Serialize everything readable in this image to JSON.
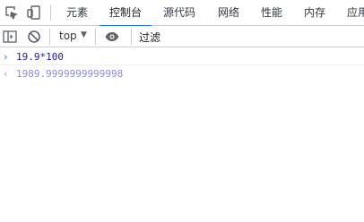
{
  "tabs": [
    {
      "label": "元素",
      "active": false
    },
    {
      "label": "控制台",
      "active": true
    },
    {
      "label": "源代码",
      "active": false
    },
    {
      "label": "网络",
      "active": false
    },
    {
      "label": "性能",
      "active": false
    },
    {
      "label": "内存",
      "active": false
    },
    {
      "label": "应用",
      "active": false
    }
  ],
  "toolbar": {
    "context": "top",
    "filter_label": "过滤"
  },
  "console": {
    "input": {
      "prompt_glyph": "›",
      "code": "19.9*100"
    },
    "output": {
      "prompt_glyph": "‹",
      "value": "1989.9999999999998"
    }
  },
  "colors": {
    "accent": "#1a73e8",
    "input_text": "#1a1aa6",
    "output_text": "#8c8cd9"
  }
}
